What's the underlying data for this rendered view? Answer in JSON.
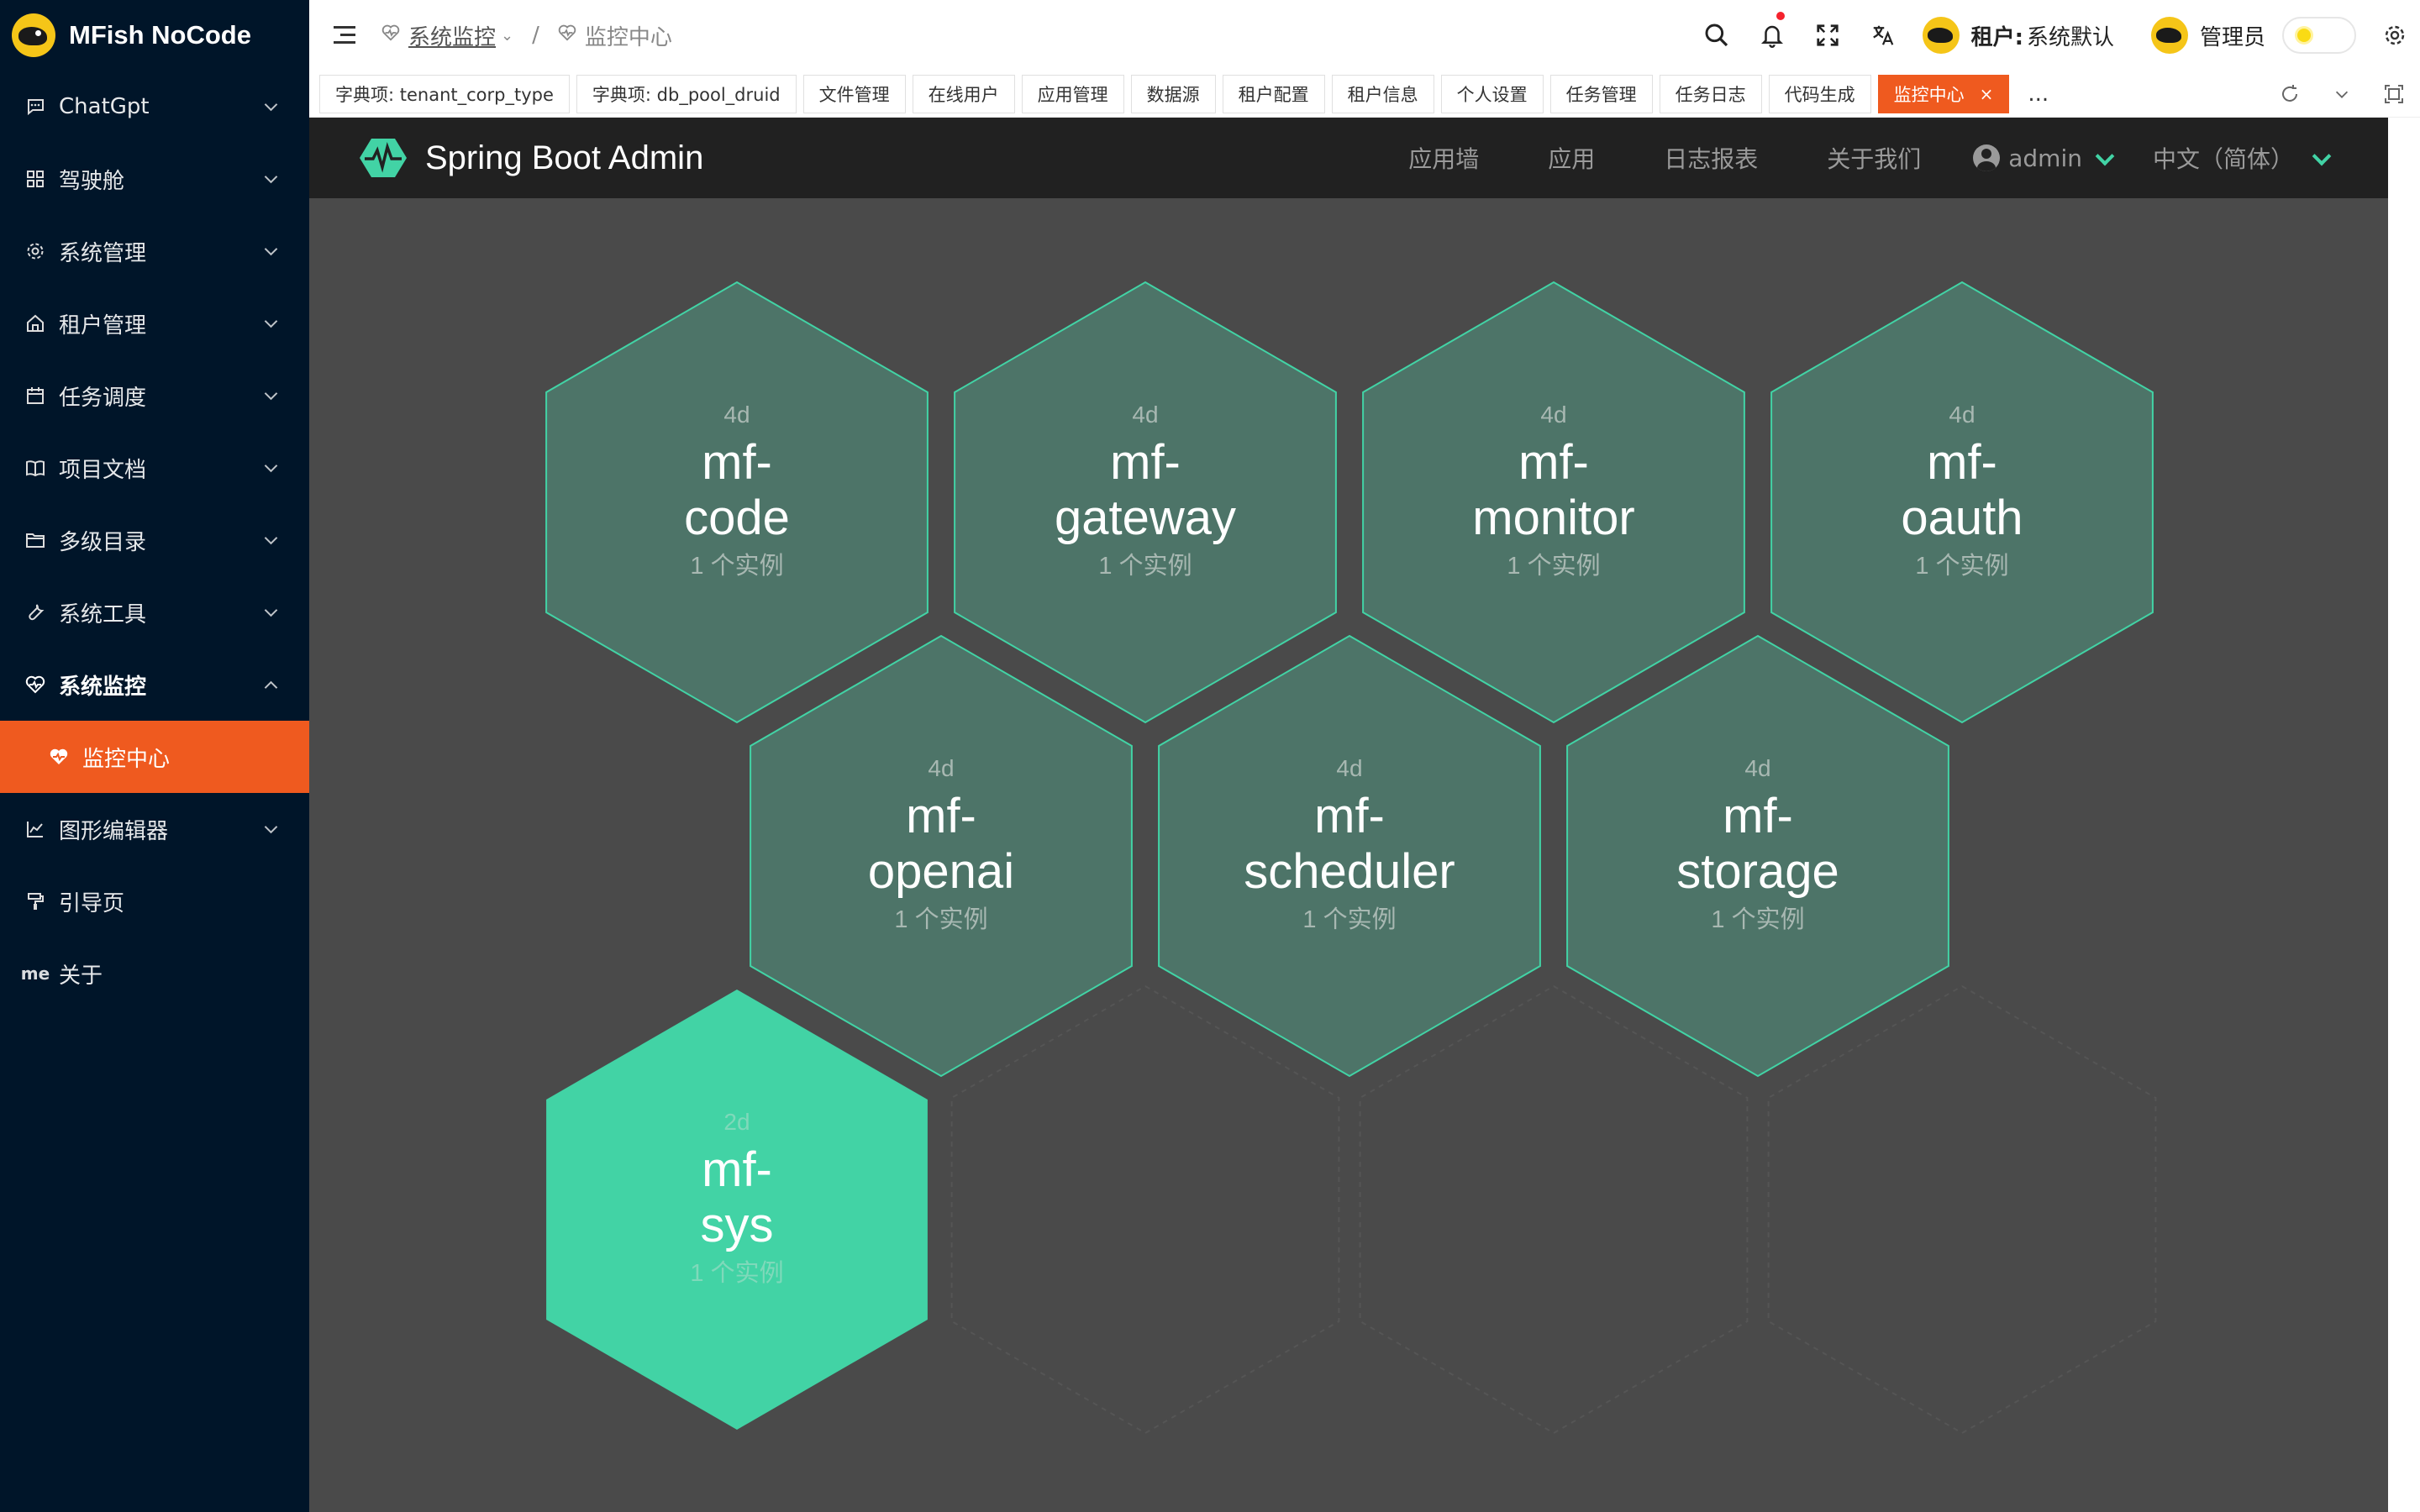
{
  "sidebar": {
    "logo_text": "MFish NoCode",
    "items": [
      {
        "label": "ChatGpt",
        "icon": "chat-icon"
      },
      {
        "label": "驾驶舱",
        "icon": "dashboard-icon"
      },
      {
        "label": "系统管理",
        "icon": "gear-icon"
      },
      {
        "label": "租户管理",
        "icon": "home-icon"
      },
      {
        "label": "任务调度",
        "icon": "calendar-icon"
      },
      {
        "label": "项目文档",
        "icon": "book-icon"
      },
      {
        "label": "多级目录",
        "icon": "folder-icon"
      },
      {
        "label": "系统工具",
        "icon": "wrench-icon"
      },
      {
        "label": "系统监控",
        "icon": "heart-pulse-icon",
        "open": true
      },
      {
        "label": "图形编辑器",
        "icon": "chart-icon"
      },
      {
        "label": "引导页",
        "icon": "paint-roller-icon"
      },
      {
        "label": "关于",
        "icon": "me-icon",
        "icon_text": "me"
      }
    ],
    "active_sub": {
      "label": "监控中心",
      "icon": "heart-pulse-icon"
    }
  },
  "header": {
    "breadcrumb": [
      {
        "label": "系统监控",
        "icon": "heart-pulse-icon"
      },
      {
        "label": "监控中心",
        "icon": "heart-pulse-icon"
      }
    ],
    "breadcrumb_separator": "/",
    "tenant_label": "租户:",
    "tenant_value": "系统默认",
    "user_name": "管理员"
  },
  "tabs": [
    {
      "label": "字典项: tenant_corp_type"
    },
    {
      "label": "字典项: db_pool_druid"
    },
    {
      "label": "文件管理"
    },
    {
      "label": "在线用户"
    },
    {
      "label": "应用管理"
    },
    {
      "label": "数据源"
    },
    {
      "label": "租户配置"
    },
    {
      "label": "租户信息"
    },
    {
      "label": "个人设置"
    },
    {
      "label": "任务管理"
    },
    {
      "label": "任务日志"
    },
    {
      "label": "代码生成"
    },
    {
      "label": "监控中心",
      "active": true
    }
  ],
  "tabs_more": "...",
  "tab_close": "×",
  "sba": {
    "title": "Spring Boot Admin",
    "nav": [
      "应用墙",
      "应用",
      "日志报表",
      "关于我们"
    ],
    "user": "admin",
    "language": "中文（简体）",
    "accent_color": "#42d3a5",
    "apps": [
      {
        "age": "4d",
        "name_line1": "mf-",
        "name_line2": "code",
        "instances": "1 个实例",
        "status": "normal"
      },
      {
        "age": "4d",
        "name_line1": "mf-",
        "name_line2": "gateway",
        "instances": "1 个实例",
        "status": "normal"
      },
      {
        "age": "4d",
        "name_line1": "mf-",
        "name_line2": "monitor",
        "instances": "1 个实例",
        "status": "normal"
      },
      {
        "age": "4d",
        "name_line1": "mf-",
        "name_line2": "oauth",
        "instances": "1 个实例",
        "status": "normal"
      },
      {
        "age": "4d",
        "name_line1": "mf-",
        "name_line2": "openai",
        "instances": "1 个实例",
        "status": "normal"
      },
      {
        "age": "4d",
        "name_line1": "mf-",
        "name_line2": "scheduler",
        "instances": "1 个实例",
        "status": "normal"
      },
      {
        "age": "4d",
        "name_line1": "mf-",
        "name_line2": "storage",
        "instances": "1 个实例",
        "status": "normal"
      },
      {
        "age": "2d",
        "name_line1": "mf-",
        "name_line2": "sys",
        "instances": "1 个实例",
        "status": "highlight"
      }
    ]
  }
}
